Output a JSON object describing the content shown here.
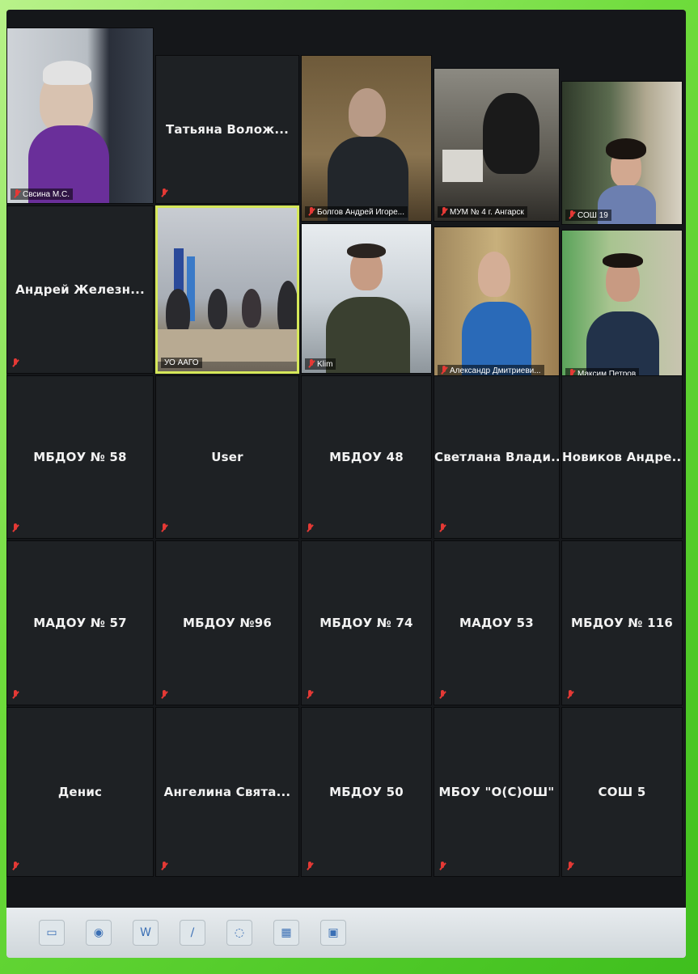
{
  "participants": {
    "row1": [
      {
        "name": "Свсина М.С.",
        "video": true
      },
      {
        "name": "Татьяна Волож...",
        "video": false
      },
      {
        "name": "Болгов Андрей Игоре...",
        "video": true
      },
      {
        "name": "МУМ № 4 г. Ангарск",
        "video": true
      },
      {
        "name": "СОШ 19",
        "video": true
      }
    ],
    "row2": [
      {
        "name": "Андрей Железн...",
        "video": false
      },
      {
        "name": "УО ААГО",
        "video": true,
        "active": true
      },
      {
        "name": "Klim",
        "video": true
      },
      {
        "name": "Александр Дмитриеви...",
        "video": true
      },
      {
        "name": "Максим Петров",
        "video": true
      }
    ],
    "row3": [
      "МБДОУ № 58",
      "User",
      "МБДОУ 48",
      "Светлана Влади...",
      "Новиков Андре..."
    ],
    "row4": [
      "МАДОУ № 57",
      "МБДОУ №96",
      "МБДОУ № 74",
      "МАДОУ 53",
      "МБДОУ № 116"
    ],
    "row5": [
      "Денис",
      "Ангелина Свята...",
      "МБДОУ 50",
      "МБОУ \"О(С)ОШ\"",
      "СОШ 5"
    ]
  },
  "taskbar": {
    "icons": [
      "folder-icon",
      "browser-icon",
      "word-icon",
      "pen-icon",
      "zoom-icon",
      "settings-icon",
      "monitor-icon"
    ],
    "glyphs": [
      "▭",
      "◉",
      "W",
      "/",
      "◌",
      "▦",
      "▣"
    ]
  }
}
